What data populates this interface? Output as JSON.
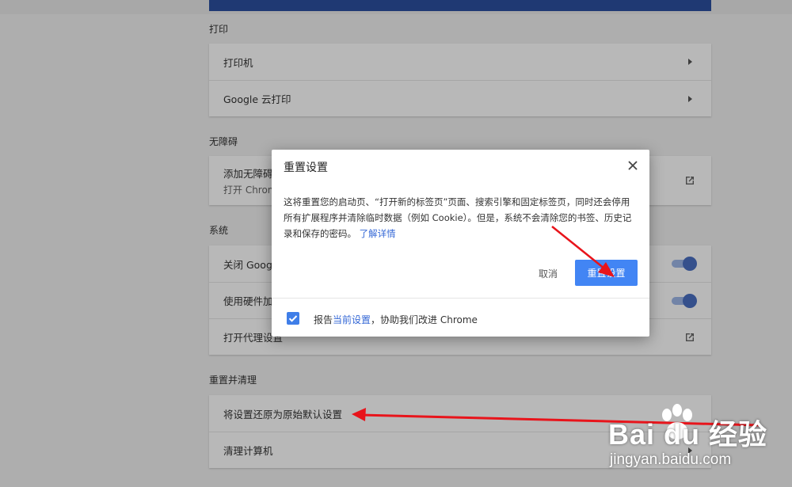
{
  "sections": {
    "print": {
      "title": "打印",
      "items": [
        {
          "label": "打印机"
        },
        {
          "label": "Google 云打印"
        }
      ]
    },
    "accessibility": {
      "title": "无障碍",
      "item_label": "添加无障碍",
      "item_sub": "打开 Chrom"
    },
    "system": {
      "title": "系统",
      "items": [
        {
          "label": "关闭 Googl"
        },
        {
          "label": "使用硬件加"
        },
        {
          "label": "打开代理设置"
        }
      ]
    },
    "reset": {
      "title": "重置并清理",
      "items": [
        {
          "label": "将设置还原为原始默认设置"
        },
        {
          "label": "清理计算机"
        }
      ]
    }
  },
  "dialog": {
    "title": "重置设置",
    "body": "这将重置您的启动页、“打开新的标签页”页面、搜索引擎和固定标签页，同时还会停用所有扩展程序并清除临时数据（例如 Cookie）。但是，系统不会清除您的书签、历史记录和保存的密码。",
    "learn_more": "了解详情",
    "cancel": "取消",
    "confirm": "重置设置",
    "footer_prefix": "报告",
    "footer_link": "当前设置",
    "footer_suffix": "，协助我们改进 Chrome",
    "checkbox_checked": true
  },
  "watermark": {
    "main": "Bai du 经验",
    "sub": "jingyan.baidu.com"
  },
  "colors": {
    "accent": "#4285f4",
    "link": "#3367d6",
    "annotation": "#e8141b",
    "header": "#2b4fa0"
  }
}
